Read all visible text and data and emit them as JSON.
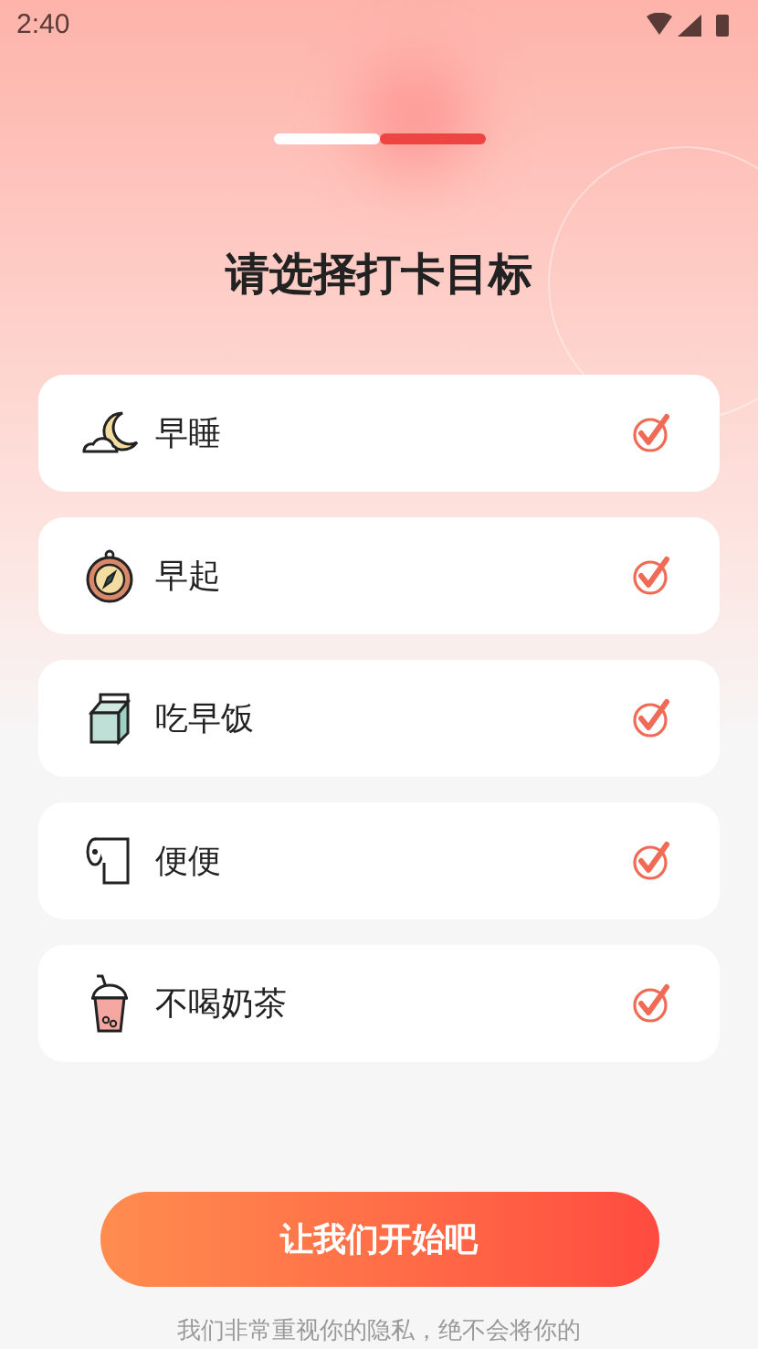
{
  "status_bar": {
    "time": "2:40"
  },
  "steps": [
    {
      "selected": false
    },
    {
      "selected": true
    }
  ],
  "title": "请选择打卡目标",
  "goals": [
    {
      "kind": "sleep",
      "label": "早睡",
      "checked": true
    },
    {
      "kind": "wake",
      "label": "早起",
      "checked": true
    },
    {
      "kind": "breakfast",
      "label": "吃早饭",
      "checked": true
    },
    {
      "kind": "toilet",
      "label": "便便",
      "checked": true
    },
    {
      "kind": "tea",
      "label": "不喝奶茶",
      "checked": true
    }
  ],
  "start_button": "让我们开始吧",
  "privacy_note": "我们非常重视你的隐私，绝不会将你的"
}
